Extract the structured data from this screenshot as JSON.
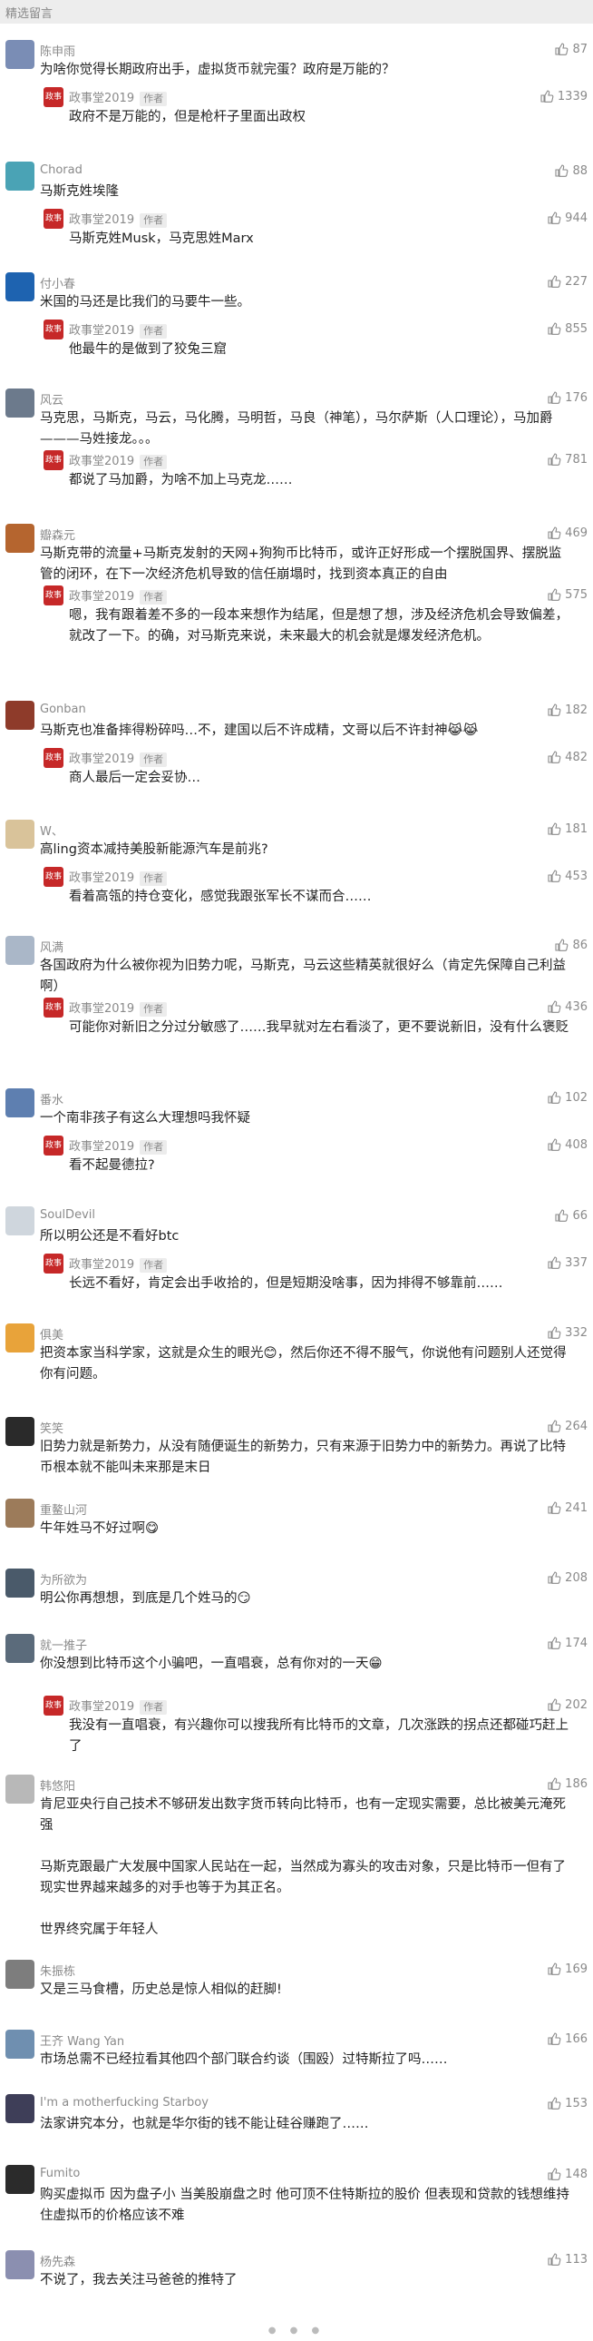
{
  "section_title": "精选留言",
  "author_badge": "作者",
  "colors": {
    "reply_avatar": "#c62828",
    "text": "#222222",
    "meta": "#8a8a8a"
  },
  "comments": [
    {
      "nick": "陈申雨",
      "likes": "87",
      "text": "为啥你觉得长期政府出手，虚拟货币就完蛋？政府是万能的？",
      "reply": {
        "nick": "政事堂2019",
        "likes": "1339",
        "text": "政府不是万能的，但是枪杆子里面出政权"
      }
    },
    {
      "nick": "Chorad",
      "likes": "88",
      "text": "马斯克姓埃隆",
      "reply": {
        "nick": "政事堂2019",
        "likes": "944",
        "text": "马斯克姓Musk，马克思姓Marx"
      }
    },
    {
      "nick": "付小春",
      "likes": "227",
      "text": "米国的马还是比我们的马要牛一些。",
      "reply": {
        "nick": "政事堂2019",
        "likes": "855",
        "text": "他最牛的是做到了狡兔三窟"
      }
    },
    {
      "nick": "风云",
      "likes": "176",
      "text": "马克思，马斯克，马云，马化腾，马明哲，马良（神笔），马尔萨斯（人口理论），马加爵———马姓接龙。。。",
      "reply": {
        "nick": "政事堂2019",
        "likes": "781",
        "text": "都说了马加爵，为啥不加上马克龙……"
      }
    },
    {
      "nick": "瓣森元",
      "likes": "469",
      "text": "马斯克带的流量+马斯克发射的天网+狗狗币比特币，或许正好形成一个摆脱国界、摆脱监管的闭环，在下一次经济危机导致的信任崩塌时，找到资本真正的自由",
      "reply": {
        "nick": "政事堂2019",
        "likes": "575",
        "text": "嗯，我有跟着差不多的一段本来想作为结尾，但是想了想，涉及经济危机会导致偏差，就改了一下。的确，对马斯克来说，未来最大的机会就是爆发经济危机。"
      }
    },
    {
      "nick": "Gonban",
      "likes": "182",
      "text": "马斯克也准备摔得粉碎吗…不，建国以后不许成精，文哥以后不许封神😹😹",
      "reply": {
        "nick": "政事堂2019",
        "likes": "482",
        "text": "商人最后一定会妥协…"
      }
    },
    {
      "nick": "W、",
      "likes": "181",
      "text": "高ling资本减持美股新能源汽车是前兆?",
      "reply": {
        "nick": "政事堂2019",
        "likes": "453",
        "text": "看着高瓴的持仓变化，感觉我跟张军长不谋而合……"
      }
    },
    {
      "nick": "风满",
      "likes": "86",
      "text": "各国政府为什么被你视为旧势力呢，马斯克，马云这些精英就很好么（肯定先保障自己利益啊）",
      "reply": {
        "nick": "政事堂2019",
        "likes": "436",
        "text": "可能你对新旧之分过分敏感了……我早就对左右看淡了，更不要说新旧，没有什么褒贬"
      }
    },
    {
      "nick": "番水",
      "likes": "102",
      "text": "一个南非孩子有这么大理想吗我怀疑",
      "reply": {
        "nick": "政事堂2019",
        "likes": "408",
        "text": "看不起曼德拉?"
      }
    },
    {
      "nick": "SoulDevil",
      "likes": "66",
      "text": "所以明公还是不看好btc",
      "reply": {
        "nick": "政事堂2019",
        "likes": "337",
        "text": "长远不看好，肯定会出手收拾的，但是短期没啥事，因为排得不够靠前……"
      }
    },
    {
      "nick": "俱美",
      "likes": "332",
      "text": "把资本家当科学家，这就是众生的眼光😊，然后你还不得不服气，你说他有问题别人还觉得你有问题。",
      "reply": null
    },
    {
      "nick": "笑笑",
      "likes": "264",
      "text": "旧势力就是新势力，从没有随便诞生的新势力，只有来源于旧势力中的新势力。再说了比特币根本就不能叫未来那是末日",
      "reply": null
    },
    {
      "nick": "重鳌山河",
      "likes": "241",
      "text": "牛年姓马不好过啊😋",
      "reply": null
    },
    {
      "nick": "为所欲为",
      "likes": "208",
      "text": "明公你再想想，到底是几个姓马的😏",
      "reply": null
    },
    {
      "nick": "就一推子",
      "likes": "174",
      "text": "你没想到比特币这个小骗吧，一直唱衰，总有你对的一天😁",
      "reply": {
        "nick": "政事堂2019",
        "likes": "202",
        "text": "我没有一直唱衰，有兴趣你可以搜我所有比特币的文章，几次涨跌的拐点还都碰巧赶上了"
      }
    },
    {
      "nick": "韩悠阳",
      "likes": "186",
      "text": "肯尼亚央行自己技术不够研发出数字货币转向比特币，也有一定现实需要，总比被美元淹死强\n\n马斯克跟最广大发展中国家人民站在一起，当然成为寡头的攻击对象，只是比特币一但有了现实世界越来越多的对手也等于为其正名。\n\n世界终究属于年轻人",
      "reply": null
    },
    {
      "nick": "朱振栋",
      "likes": "169",
      "text": "又是三马食槽，历史总是惊人相似的赶脚!",
      "reply": null
    },
    {
      "nick": "王齐 Wang Yan",
      "likes": "166",
      "text": "市场总需不已经拉看其他四个部门联合约谈（围殴）过特斯拉了吗……",
      "reply": null
    },
    {
      "nick": "I'm a motherfucking Starboy",
      "likes": "153",
      "text": "法家讲究本分，也就是华尔街的钱不能让硅谷赚跑了……",
      "reply": null
    },
    {
      "nick": "Fumito",
      "likes": "148",
      "text": "购买虚拟币 因为盘子小 当美股崩盘之时 他可顶不住特斯拉的股价 但表现和贷款的钱想维持住虚拟币的价格应该不难",
      "reply": null
    },
    {
      "nick": "杨先森",
      "likes": "113",
      "text": "不说了，我去关注马爸爸的推特了",
      "reply": null
    }
  ],
  "reply_avatar_text": "政事堂"
}
